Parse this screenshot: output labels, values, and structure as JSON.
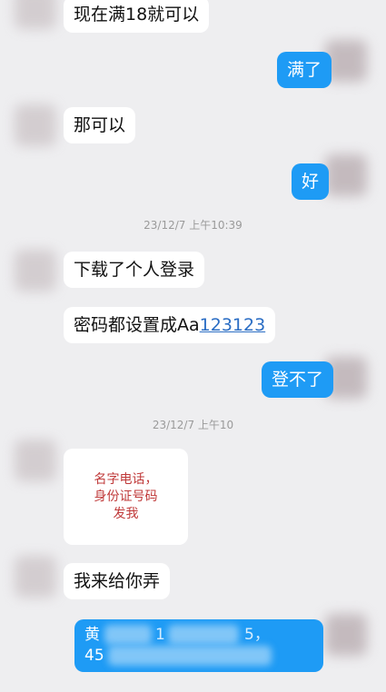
{
  "messages": {
    "m1": "现在满18就可以",
    "m2": "满了",
    "m3": "那可以",
    "m4": "好",
    "m5": "下载了个人登录",
    "m6_prefix": "密码都设置成Aa",
    "m6_link": "123123",
    "m7": "登不了",
    "m8": "我来给你弄"
  },
  "timestamps": {
    "t1": "23/12/7 上午10:39",
    "t2": "23/12/7 上午10"
  },
  "card": {
    "line1": "名字电话，",
    "line2": "身份证号码",
    "line3": "发我"
  },
  "redacted": {
    "start1": "黄",
    "mid1": "1",
    "end1": "5，",
    "start2": "45"
  },
  "colors": {
    "background": "#eeeef0",
    "incoming_bubble": "#ffffff",
    "outgoing_bubble": "#1e9bf5",
    "timestamp": "#9a9a9a",
    "link": "#2a6dc4",
    "card_text": "#c03b3b"
  }
}
